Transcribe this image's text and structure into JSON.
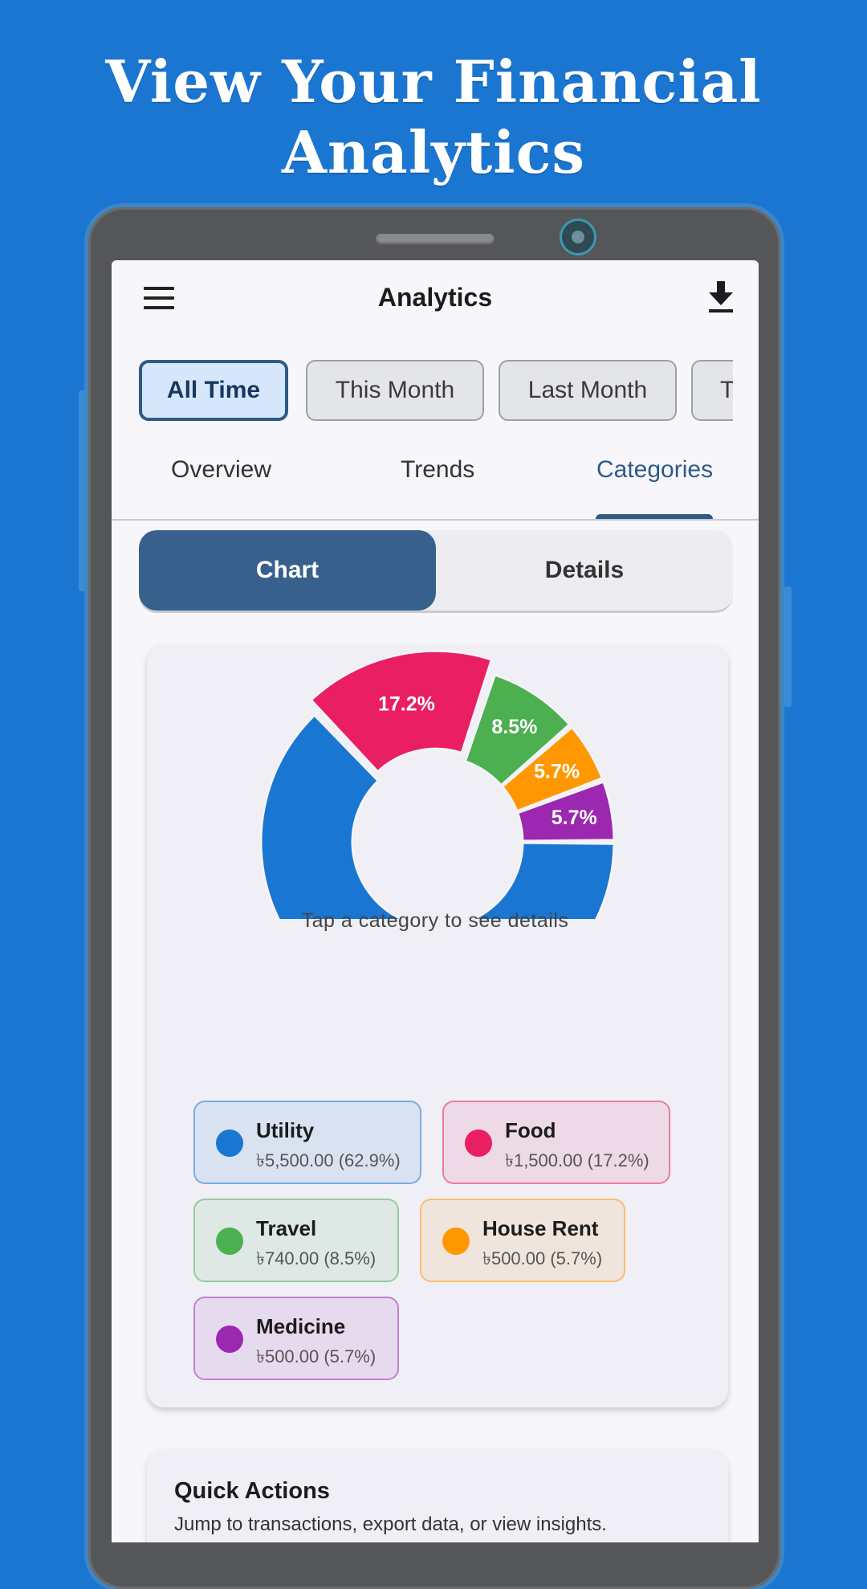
{
  "promo": {
    "title_line1": "View Your Financial",
    "title_line2": "Analytics"
  },
  "appbar": {
    "title": "Analytics",
    "menu_icon": "hamburger-menu-icon",
    "download_icon": "download-icon"
  },
  "filters": {
    "chips": [
      {
        "label": "All Time",
        "active": true
      },
      {
        "label": "This Month",
        "active": false
      },
      {
        "label": "Last Month",
        "active": false
      },
      {
        "label": "Th",
        "active": false
      }
    ]
  },
  "tabs": [
    {
      "label": "Overview",
      "active": false
    },
    {
      "label": "Trends",
      "active": false
    },
    {
      "label": "Categories",
      "active": true
    }
  ],
  "segmented": {
    "chart_label": "Chart",
    "details_label": "Details",
    "selected": "Chart"
  },
  "chart_data": {
    "type": "pie",
    "title": "",
    "categories": [
      "Utility",
      "Food",
      "Travel",
      "House Rent",
      "Medicine"
    ],
    "values": [
      62.9,
      17.2,
      8.5,
      5.7,
      5.7
    ],
    "labels": [
      "62.9%",
      "17.2%",
      "8.5%",
      "5.7%",
      "5.7%"
    ],
    "colors": [
      "#1976d2",
      "#e91e63",
      "#4caf50",
      "#ff9800",
      "#9c27b0"
    ],
    "selected_category": "Food"
  },
  "categories": {
    "hint": "Tap a category to see details",
    "items": [
      {
        "name": "Utility",
        "amount": "৳5,500.00 (62.9%)",
        "color": "#1976d2"
      },
      {
        "name": "Food",
        "amount": "৳1,500.00 (17.2%)",
        "color": "#e91e63"
      },
      {
        "name": "Travel",
        "amount": "৳740.00 (8.5%)",
        "color": "#4caf50"
      },
      {
        "name": "House Rent",
        "amount": "৳500.00 (5.7%)",
        "color": "#ff9800"
      },
      {
        "name": "Medicine",
        "amount": "৳500.00 (5.7%)",
        "color": "#9c27b0"
      }
    ]
  },
  "quick_actions": {
    "title": "Quick Actions",
    "subtitle": "Jump to transactions, export data, or view insights."
  }
}
